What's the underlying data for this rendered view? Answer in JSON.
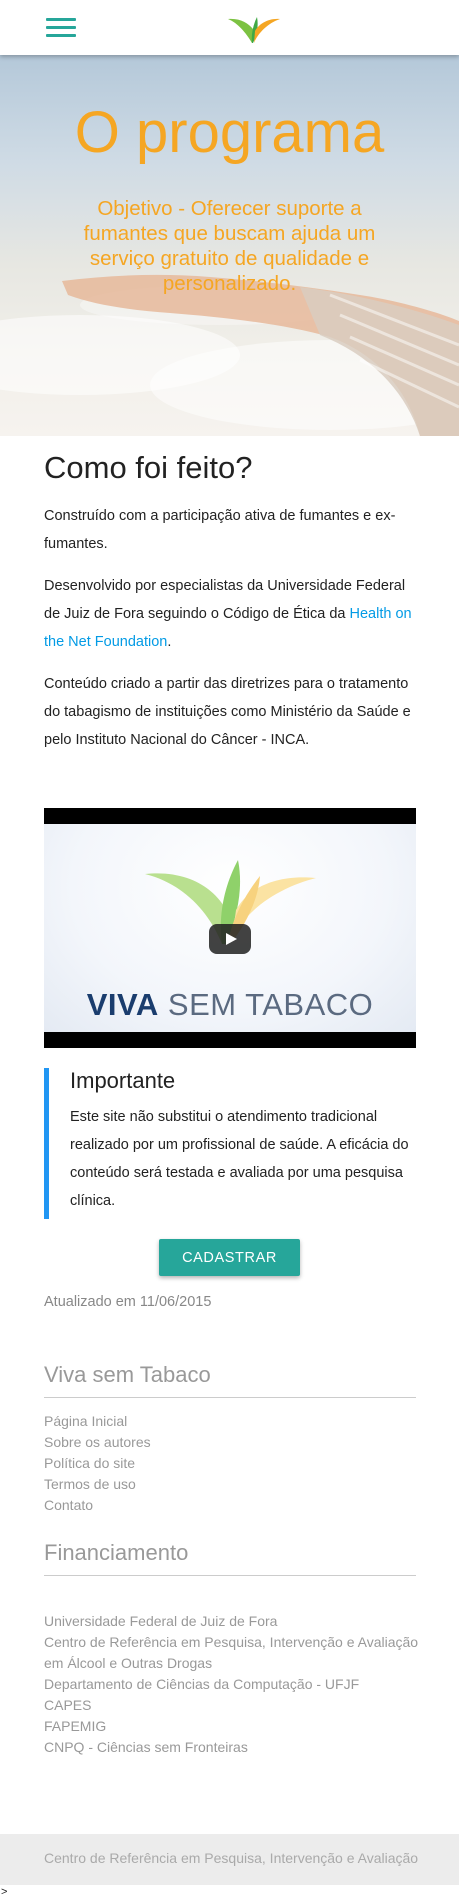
{
  "hero": {
    "title": "O programa",
    "subtitle": "Objetivo - Oferecer suporte a fumantes que buscam ajuda um serviço gratuito de qualidade e personalizado."
  },
  "como": {
    "title": "Como foi feito?",
    "p1": "Construído com a participação ativa de fumantes e ex-fumantes.",
    "p2_prefix": "Desenvolvido por especialistas da Universidade Federal de Juiz de Fora seguindo o Código de Ética da ",
    "p2_link": "Health on the Net Foundation",
    "p2_suffix": ".",
    "p3": "Conteúdo criado a partir das diretrizes para o tratamento do tabagismo de instituições como Ministério da Saúde e pelo Instituto Nacional do Câncer - INCA."
  },
  "video": {
    "word1": "VIVA",
    "word2": "SEM TABACO"
  },
  "importante": {
    "title": "Importante",
    "text": "Este site não substitui o atendimento tradicional realizado por um profissional de saúde. A eficácia do conteúdo será testada e avaliada por uma pesquisa clínica."
  },
  "cadastrar_label": "Cadastrar",
  "updated": "Atualizado em 11/06/2015",
  "footer": {
    "site_title": "Viva sem Tabaco",
    "site_links": [
      "Página Inicial",
      "Sobre os autores",
      "Política do site",
      "Termos de uso",
      "Contato"
    ],
    "fin_title": "Financiamento",
    "fin_items": [
      "Universidade Federal de Juiz de Fora",
      "Centro de Referência em Pesquisa, Intervenção e Avaliação em Álcool e Outras Drogas",
      "Departamento de Ciências da Computação - UFJF",
      "CAPES",
      "FAPEMIG",
      "CNPQ - Ciências sem Fronteiras"
    ],
    "bottom_text": "Centro de Referência em Pesquisa, Intervenção e Avaliação"
  },
  "stray_char": ">",
  "colors": {
    "teal": "#26a69a",
    "orange": "#f5a623",
    "link": "#039be5",
    "accent_border": "#2196f3"
  },
  "icons": {
    "menu": "menu-icon",
    "logo": "butterfly-logo-icon",
    "play": "play-icon"
  }
}
